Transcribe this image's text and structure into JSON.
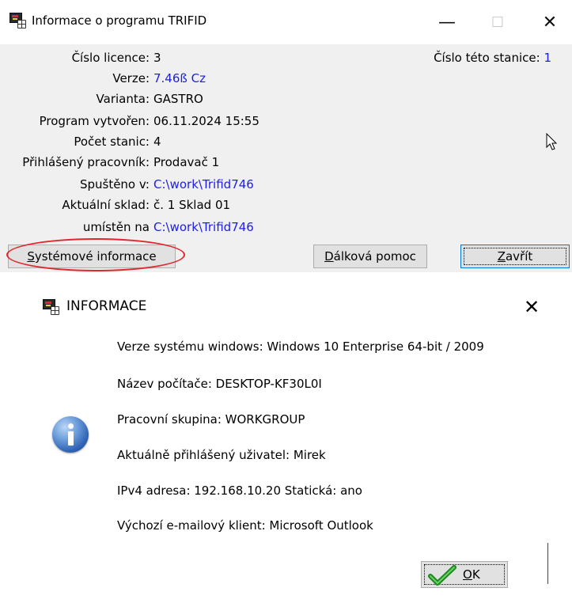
{
  "window1": {
    "title": "Informace o programu TRIFID",
    "controls": {
      "minimize": "—",
      "maximize": "☐",
      "close": "✕"
    },
    "fields": [
      {
        "label": "Číslo licence:",
        "value": "3",
        "color": "#000000"
      },
      {
        "label": "Verze:",
        "value": "7.46ß  Cz",
        "color": "#1e1ee0"
      },
      {
        "label": "Varianta:",
        "value": "GASTRO",
        "color": "#000000"
      },
      {
        "label": "Program vytvořen:",
        "value": "06.11.2024  15:55",
        "color": "#000000"
      },
      {
        "label": "Počet stanic:",
        "value": "4",
        "color": "#000000"
      },
      {
        "label": "Přihlášený pracovník:",
        "value": "Prodavač 1",
        "color": "#000000"
      },
      {
        "label": "Spuštěno v:",
        "value": "C:\\work\\Trifid746",
        "color": "#1e1ee0"
      },
      {
        "label": "Aktuální sklad:",
        "value": "č. 1   Sklad 01",
        "color": "#000000"
      },
      {
        "label": "umístěn na",
        "value": "C:\\work\\Trifid746",
        "color": "#1e1ee0"
      }
    ],
    "station": {
      "label": "Číslo této stanice:",
      "value": "1"
    },
    "buttons": {
      "system_info": {
        "mnemonic": "S",
        "rest": "ystémové informace"
      },
      "remote_help": {
        "mnemonic": "D",
        "rest": "álková pomoc"
      },
      "close": {
        "mnemonic": "Z",
        "rest": "avřít"
      }
    },
    "highlight_color": "#e0282e"
  },
  "window2": {
    "title": "INFORMACE",
    "close": "✕",
    "lines": [
      "Verze systému windows: Windows 10 Enterprise 64-bit / 2009",
      "Název počítače: DESKTOP-KF30L0I",
      "Pracovní skupina: WORKGROUP",
      "Aktuálně přihlášený uživatel: Mirek",
      "IPv4 adresa: 192.168.10.20   Statická: ano",
      "Výchozí e-mailový klient: Microsoft Outlook"
    ],
    "ok_button": {
      "mnemonic": "O",
      "rest": "K"
    },
    "icon": "info-icon"
  }
}
